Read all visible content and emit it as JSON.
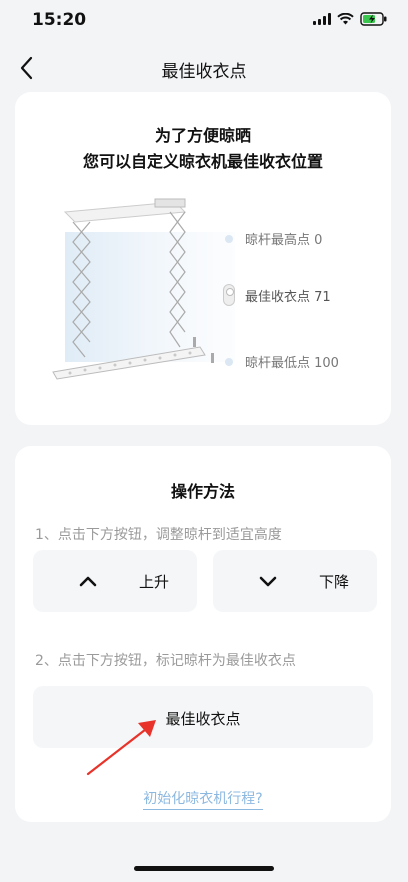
{
  "status": {
    "time": "15:20"
  },
  "nav": {
    "title": "最佳收衣点"
  },
  "intro": {
    "line1": "为了方便晾晒",
    "line2": "您可以自定义晾衣机最佳收衣位置",
    "legend": [
      {
        "label": "晾杆最高点 0"
      },
      {
        "label": "最佳收衣点 71"
      },
      {
        "label": "晾杆最低点 100"
      }
    ]
  },
  "method": {
    "title": "操作方法",
    "step1": "1、点击下方按钮，调整晾杆到适宜高度",
    "up_label": "上升",
    "down_label": "下降",
    "step2": "2、点击下方按钮，标记晾杆为最佳收衣点",
    "mark_label": "最佳收衣点",
    "init_link": "初始化晾衣机行程?"
  },
  "colors": {
    "accent": "#8cb8e0",
    "annotation": "#e8332a"
  }
}
